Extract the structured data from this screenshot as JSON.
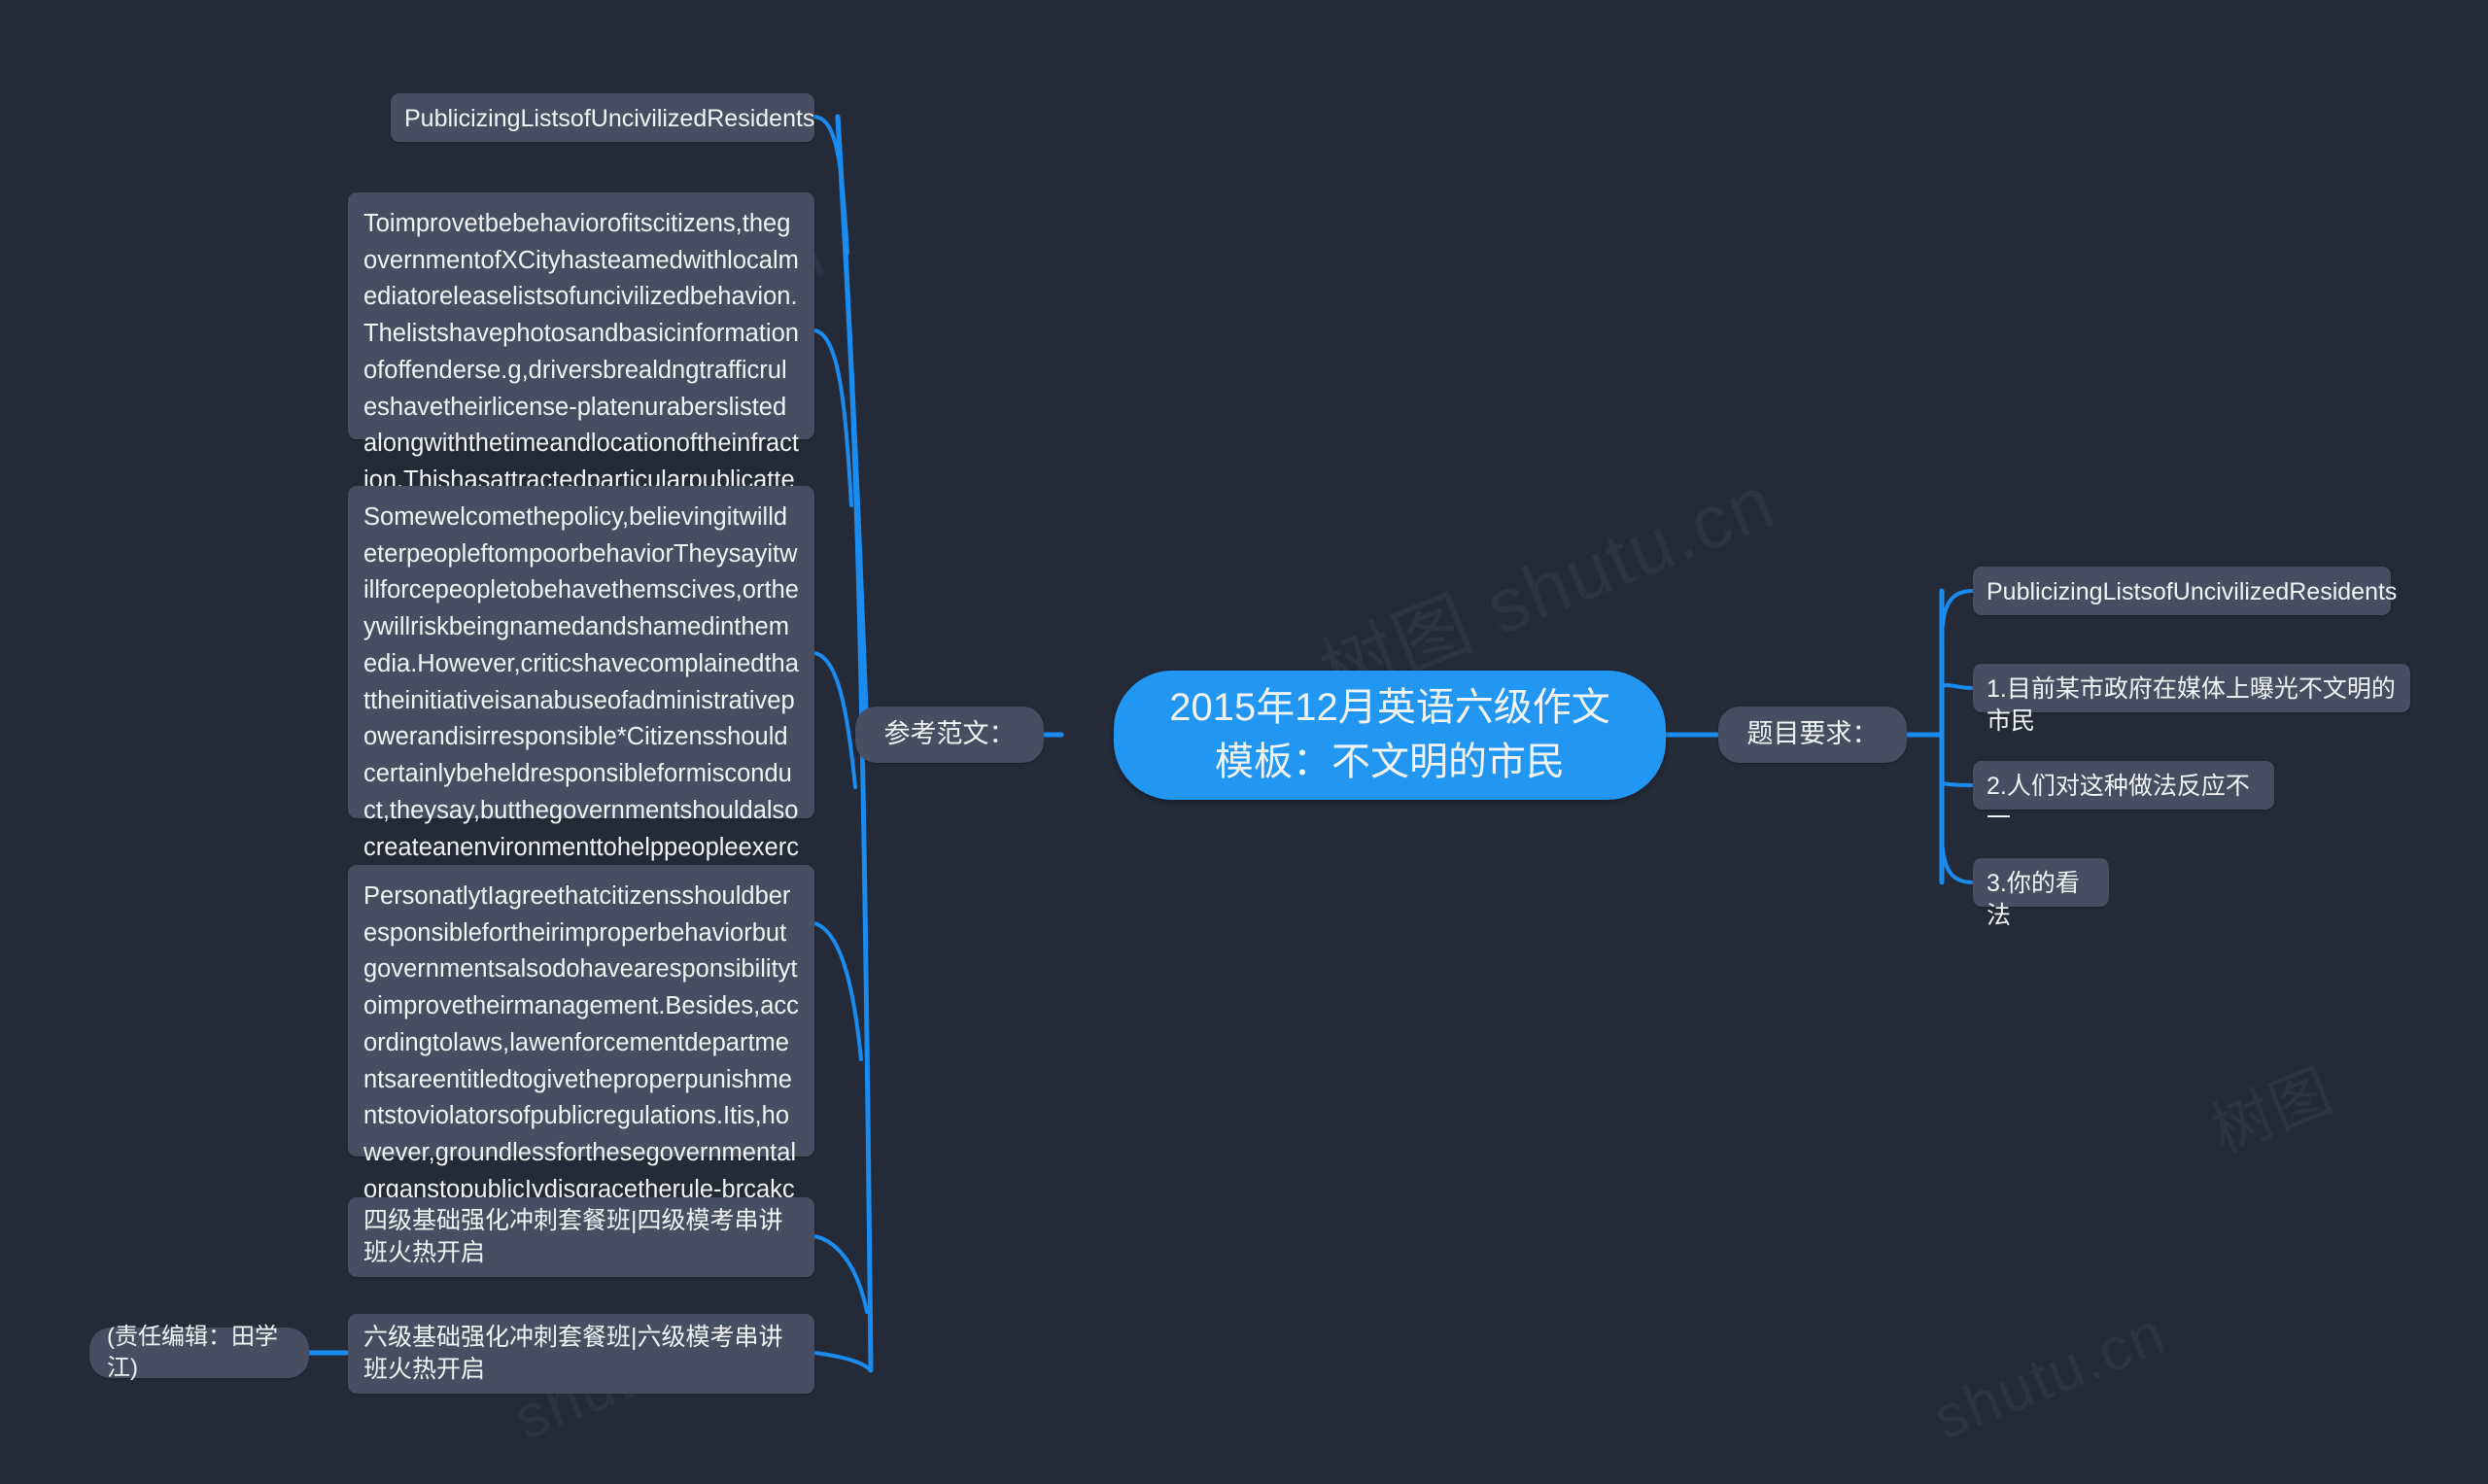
{
  "canvas": {
    "background": "#252a38",
    "node_fill": "#474e61",
    "root_fill": "#2196f3",
    "link_color": "#1a8cf0",
    "text_color": "#f2f4f8"
  },
  "watermarks": [
    {
      "text": "shutu.cn"
    },
    {
      "text": "树图 shutu.cn"
    },
    {
      "text": "shutu.cn"
    },
    {
      "text": "shutu.cn"
    },
    {
      "text": "树图"
    }
  ],
  "root": {
    "label": "2015年12月英语六级作文模板：不文明的市民",
    "line1": "2015年12月英语六级作文",
    "line2": "模板：不文明的市民"
  },
  "branches": {
    "right": {
      "topic": "题目要求：",
      "children": [
        {
          "label": "PublicizingListsofUncivilizedResidents"
        },
        {
          "label": "1.目前某市政府在媒体上曝光不文明的市民"
        },
        {
          "label": "2.人们对这种做法反应不一"
        },
        {
          "label": "3.你的看法"
        }
      ]
    },
    "left": {
      "topic": "参考范文：",
      "children": [
        {
          "label": "PublicizingListsofUncivilizedResidents"
        },
        {
          "label": "Toimprovetbebehaviorofitscitizens,thegovernmentofXCityhasteamedwithlocalmediatoreleaselistsofuncivilizedbehavion.Thelistshavephotosandbasicinformationofoffenderse.g,driversbrealdngtrafficruleshavetheirlicense-platenuraberslistedalongwiththetimeandlocationoftheinfraction.Thishasattractedparticularpublicattention."
        },
        {
          "label": "Somewelcomethepolicy,believingitwilldeterpeopleftompoorbehaviorTheysayitwillforcepeopletobehavethemscives,ortheywillriskbeingnamedandshamedinthemedia.However,criticshavecomplainedthattheinitiativeisanabuseofadministrativepowerandisirresponsible*Citizensshouldcertainlybeheldresponsibleformisconduct,theysay,butthegovernmentshouldalsocreateanenvironmenttohelppeopleexerciseself-discipline."
        },
        {
          "label": "PersonatlytIagreethatcitizensshouldberesponsiblefortheirimproperbehaviorbutgovernmentsalsodohavearesponsibilitytoimprovetheirmanagement.Besides,accordingtolaws,lawenforcementdepartmentsareentitledtogivetheproperpunishmentstoviolatorsofpublicregulations.Itis,however,groundlessforthesegovernmentalorganstopublicIydisgracetherule-brcakcis."
        },
        {
          "label": "四级基础强化冲刺套餐班|四级模考串讲班火热开启"
        },
        {
          "label": "六级基础强化冲刺套餐班|六级模考串讲班火热开启"
        }
      ]
    },
    "editor": {
      "label": "(责任编辑：田学江)"
    }
  }
}
